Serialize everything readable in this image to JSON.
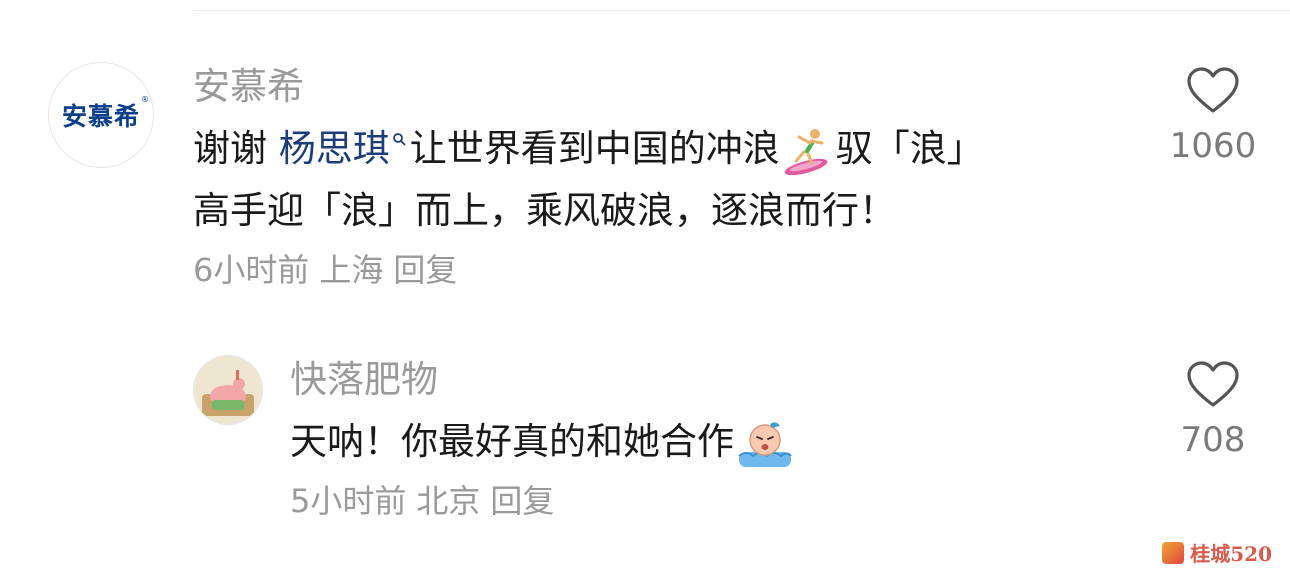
{
  "comments": [
    {
      "author": "安慕希",
      "avatar_text": "安慕希",
      "avatar_mark": "®",
      "content_prefix": "谢谢",
      "mention": "杨思琪",
      "content_mid": "让世界看到中国的冲浪",
      "content_tail_line1": "驭「浪」",
      "content_line2": "高手迎「浪」而上，乘风破浪，逐浪而行！",
      "time": "6小时前",
      "location": "上海",
      "reply_label": "回复",
      "likes": "1060"
    },
    {
      "author": "快落肥物",
      "content": "天呐！你最好真的和她合作",
      "time": "5小时前",
      "location": "北京",
      "reply_label": "回复",
      "likes": "708"
    }
  ],
  "watermark": {
    "text": "桂城520"
  },
  "colors": {
    "author": "#9a9a9a",
    "mention": "#1d3d7a",
    "brand": "#0c3f8c",
    "text": "#1a1a1a"
  }
}
